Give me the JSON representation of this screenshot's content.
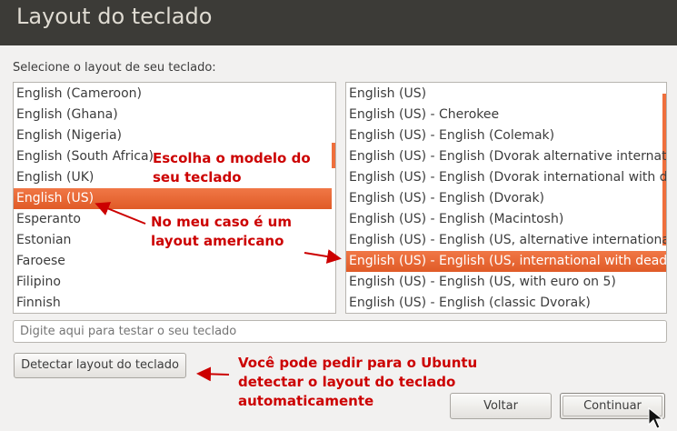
{
  "window": {
    "title": "Layout do teclado"
  },
  "prompt": "Selecione o layout de seu teclado:",
  "layout_list": {
    "items": [
      "English (Cameroon)",
      "English (Ghana)",
      "English (Nigeria)",
      "English (South Africa)",
      "English (UK)",
      "English (US)",
      "Esperanto",
      "Estonian",
      "Faroese",
      "Filipino",
      "Finnish"
    ],
    "selected": "English (US)"
  },
  "variant_list": {
    "items": [
      "English (US)",
      "English (US) - Cherokee",
      "English (US) - English (Colemak)",
      "English (US) - English (Dvorak alternative international",
      "English (US) - English (Dvorak international with dead",
      "English (US) - English (Dvorak)",
      "English (US) - English (Macintosh)",
      "English (US) - English (US, alternative international)",
      "English (US) - English (US, international with dead key",
      "English (US) - English (US, with euro on 5)",
      "English (US) - English (classic Dvorak)"
    ],
    "selected": "English (US) - English (US, international with dead key"
  },
  "test_input": {
    "placeholder": "Digite aqui para testar o seu teclado",
    "value": ""
  },
  "buttons": {
    "detect": "Detectar layout do teclado",
    "back": "Voltar",
    "continue": "Continuar"
  },
  "annotations": {
    "choose_model": "Escolha o modelo do\nseu teclado",
    "my_case": "No meu caso é um\nlayout americano",
    "ubuntu_detect": "Você pode pedir para o Ubuntu\ndetectar o layout do teclado\nautomaticamente"
  },
  "colors": {
    "selection": "#e8622f",
    "annotation": "#cc0000",
    "titlebar": "#3c3b37"
  }
}
